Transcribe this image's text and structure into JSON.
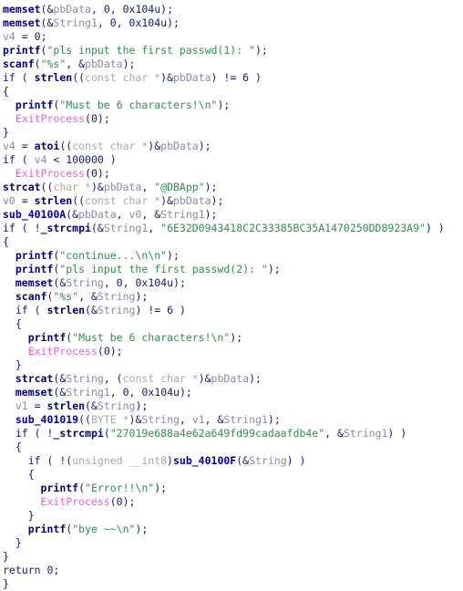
{
  "view": {
    "name": "decompiled-pseudocode",
    "background": "#ffffff",
    "font_size_px": 11.5,
    "line_height_px": 15
  },
  "colors": {
    "plain": "#16167a",
    "function": "#00007f",
    "subroutine": "#0000b0",
    "variable": "#8a8aa8",
    "type": "#a8a8a8",
    "string": "#2f8f4f",
    "number": "#16167a",
    "api_import": "#f060d0",
    "background": "#ffffff"
  },
  "code": {
    "language": "c-pseudocode",
    "lines": [
      "memset(&pbData, 0, 0x104u);",
      "memset(&String1, 0, 0x104u);",
      "v4 = 0;",
      "printf(\"pls input the first passwd(1): \");",
      "scanf(\"%s\", &pbData);",
      "if ( strlen((const char *)&pbData) != 6 )",
      "{",
      "  printf(\"Must be 6 characters!\\n\");",
      "  ExitProcess(0);",
      "}",
      "v4 = atoi((const char *)&pbData);",
      "if ( v4 < 100000 )",
      "  ExitProcess(0);",
      "strcat((char *)&pbData, \"@DBApp\");",
      "v0 = strlen((const char *)&pbData);",
      "sub_40100A(&pbData, v0, &String1);",
      "if ( !_strcmpi(&String1, \"6E32D0943418C2C33385BC35A1470250DD8923A9\") )",
      "{",
      "  printf(\"continue...\\n\\n\");",
      "  printf(\"pls input the first passwd(2): \");",
      "  memset(&String, 0, 0x104u);",
      "  scanf(\"%s\", &String);",
      "  if ( strlen(&String) != 6 )",
      "  {",
      "    printf(\"Must be 6 characters!\\n\");",
      "    ExitProcess(0);",
      "  }",
      "  strcat(&String, (const char *)&pbData);",
      "  memset(&String1, 0, 0x104u);",
      "  v1 = strlen(&String);",
      "  sub_401019((BYTE *)&String, v1, &String1);",
      "  if ( !_strcmpi(\"27019e688a4e62a649fd99cadaafdb4e\", &String1) )",
      "  {",
      "    if ( !(unsigned __int8)sub_40100F(&String) )",
      "    {",
      "      printf(\"Error!!\\n\");",
      "      ExitProcess(0);",
      "    }",
      "    printf(\"bye ~~\\n\");",
      "  }",
      "}",
      "return 0;",
      "}"
    ],
    "identifiers": {
      "variables": [
        "pbData",
        "String1",
        "String",
        "v0",
        "v1",
        "v4"
      ],
      "library_functions": [
        "memset",
        "printf",
        "scanf",
        "strlen",
        "atoi",
        "strcat",
        "_strcmpi"
      ],
      "subroutines": [
        "sub_40100A",
        "sub_401019",
        "sub_40100F"
      ],
      "api_imports": [
        "ExitProcess"
      ],
      "types": [
        "const char *",
        "char *",
        "BYTE *",
        "unsigned __int8"
      ]
    },
    "string_literals": [
      "pls input the first passwd(1): ",
      "%s",
      "Must be 6 characters!\\n",
      "@DBApp",
      "6E32D0943418C2C33385BC35A1470250DD8923A9",
      "continue...\\n\\n",
      "pls input the first passwd(2): ",
      "27019e688a4e62a649fd99cadaafdb4e",
      "Error!!\\n",
      "bye ~~\\n"
    ],
    "numeric_literals": [
      "0",
      "0x104u",
      "6",
      "100000"
    ]
  }
}
